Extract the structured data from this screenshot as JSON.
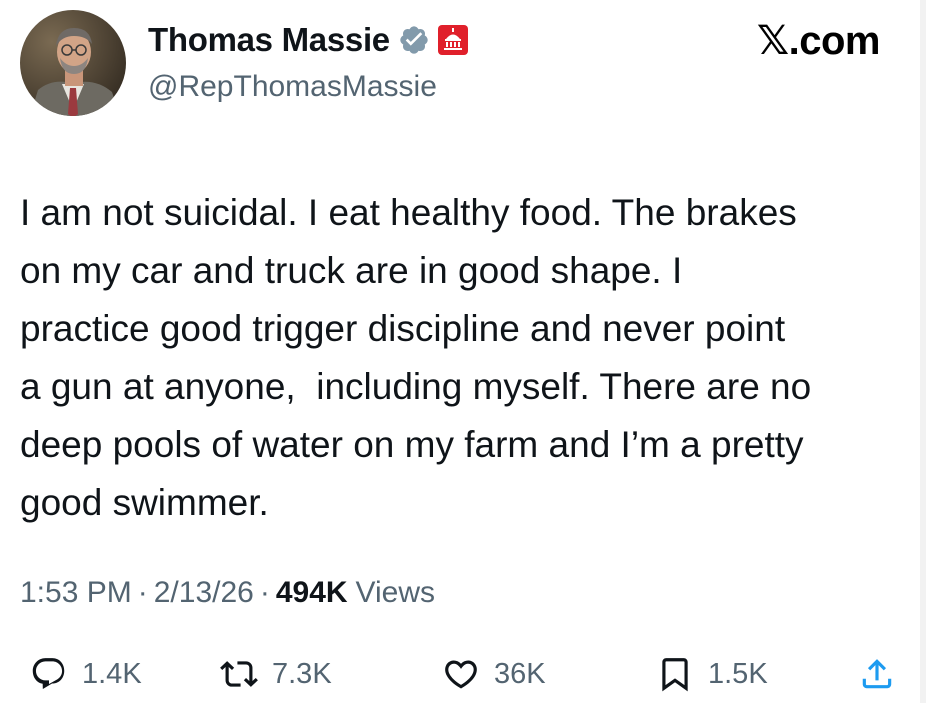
{
  "header": {
    "display_name": "Thomas Massie",
    "handle": "@RepThomasMassie",
    "brand": "𝕏.com",
    "icons": {
      "avatar": "profile-photo",
      "verified": "verified-badge-icon",
      "affiliate": "capitol-dome-badge-icon"
    },
    "colors": {
      "verified": "#829aab",
      "affiliate": "#e0202b"
    }
  },
  "tweet": {
    "lines": [
      "I am not suicidal. I eat healthy food. The brakes",
      "on my car and truck are in good shape. I",
      "practice good trigger discipline and never point",
      "a gun at anyone,  including myself. There are no",
      "deep pools of water on my farm and I’m a pretty",
      "good swimmer."
    ]
  },
  "meta": {
    "time": "1:53 PM",
    "separator": "·",
    "date": "2/13/26",
    "views_count": "494K",
    "views_label": "Views"
  },
  "actions": {
    "reply": {
      "icon": "reply-icon",
      "count": "1.4K"
    },
    "retweet": {
      "icon": "retweet-icon",
      "count": "7.3K"
    },
    "like": {
      "icon": "heart-icon",
      "count": "36K"
    },
    "bookmark": {
      "icon": "bookmark-icon",
      "count": "1.5K"
    },
    "share": {
      "icon": "share-icon"
    }
  }
}
